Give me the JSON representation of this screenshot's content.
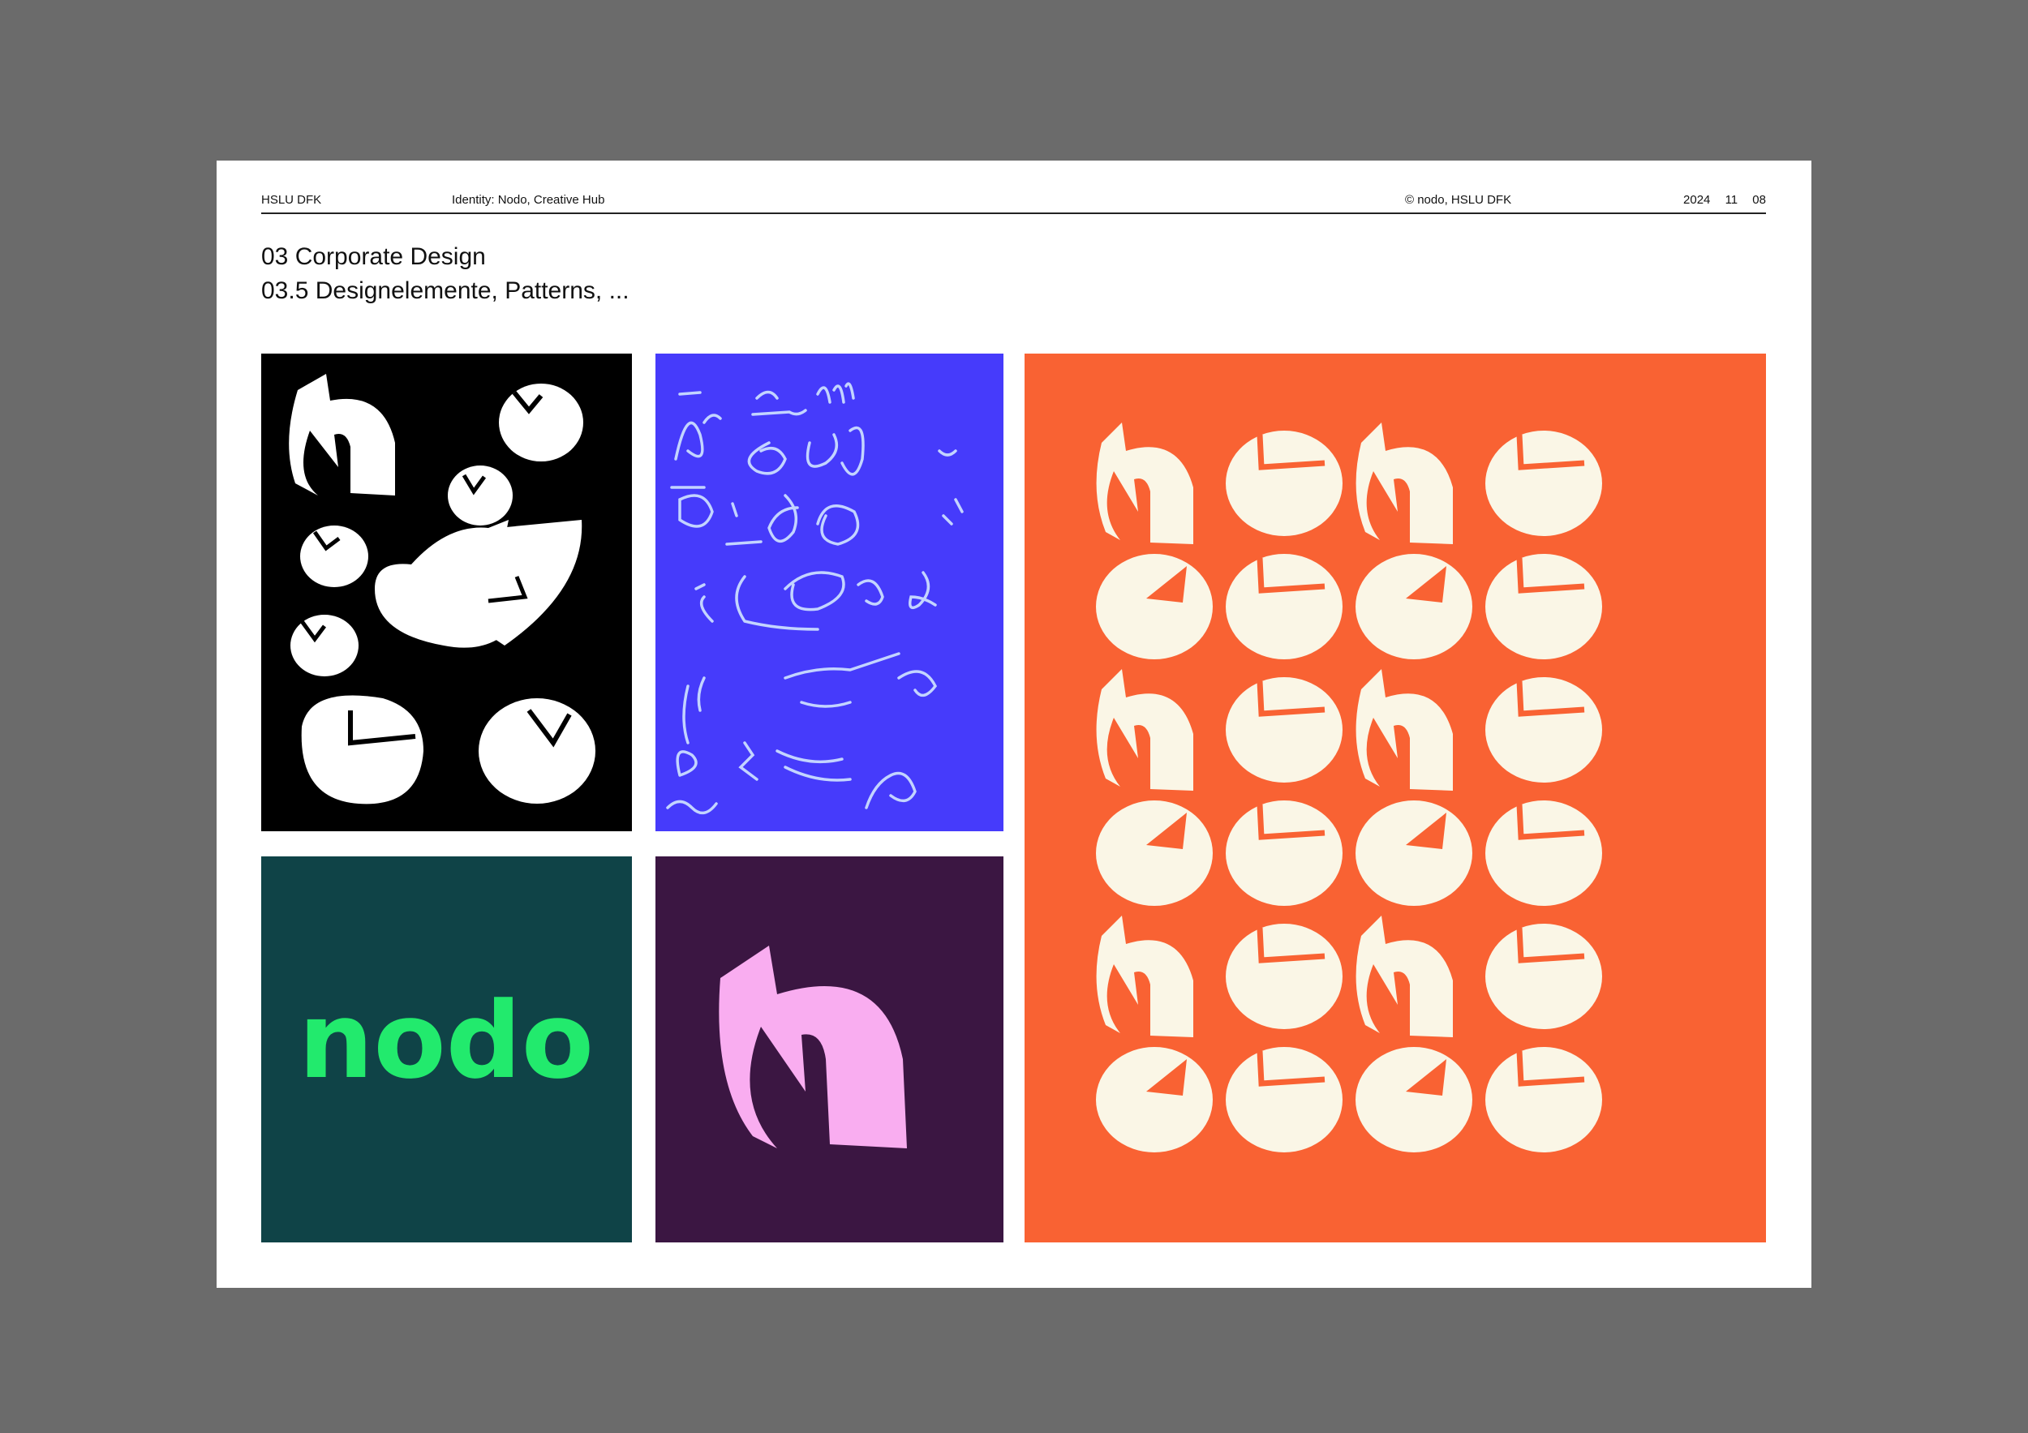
{
  "header": {
    "org": "HSLU DFK",
    "project": "Identity: Nodo, Creative Hub",
    "copyright": "© nodo, HSLU DFK",
    "date": "2024  11  08"
  },
  "title": {
    "chapter": "03 Corporate Design",
    "section": "03.5  Designelemente, Patterns, ..."
  },
  "panels": {
    "teal_logo_text": "nodo"
  },
  "colors": {
    "black_panel": "#000000",
    "blue_panel": "#463bfb",
    "orange_panel": "#f96233",
    "teal_panel": "#0f4347",
    "purple_panel": "#3b1642",
    "cream_shape": "#faf6e6",
    "pink_shape": "#f9adf0",
    "green_logo": "#22ea6d",
    "line_blue": "#c3d4ff"
  }
}
